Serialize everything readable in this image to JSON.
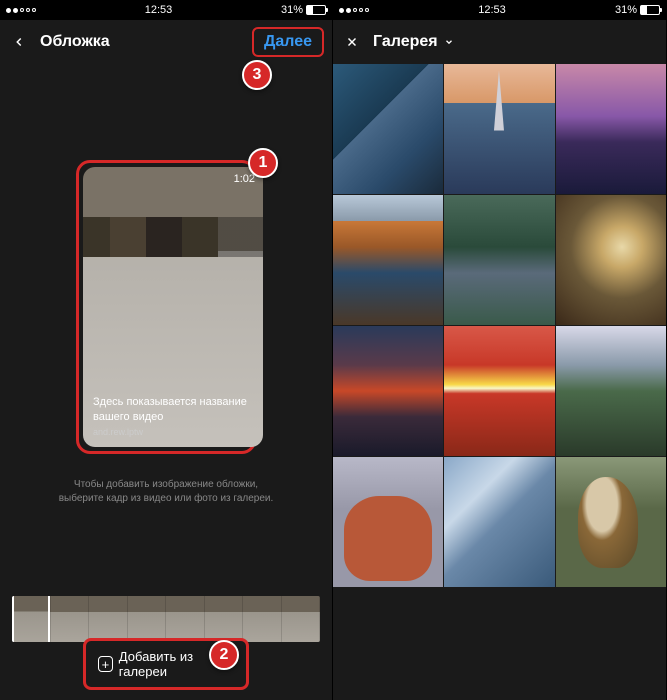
{
  "status": {
    "time": "12:53",
    "battery_pct": "31%"
  },
  "left": {
    "nav_title": "Обложка",
    "next_label": "Далее",
    "cover": {
      "duration": "1:02",
      "title_placeholder": "Здесь показывается название вашего видео",
      "author": "and.rew.lptw"
    },
    "hint_line1": "Чтобы добавить изображение обложки,",
    "hint_line2": "выберите кадр из видео или фото из галереи.",
    "add_gallery_label": "Добавить из галереи"
  },
  "right": {
    "dropdown_label": "Галерея"
  },
  "badges": {
    "b1": "1",
    "b2": "2",
    "b3": "3"
  }
}
